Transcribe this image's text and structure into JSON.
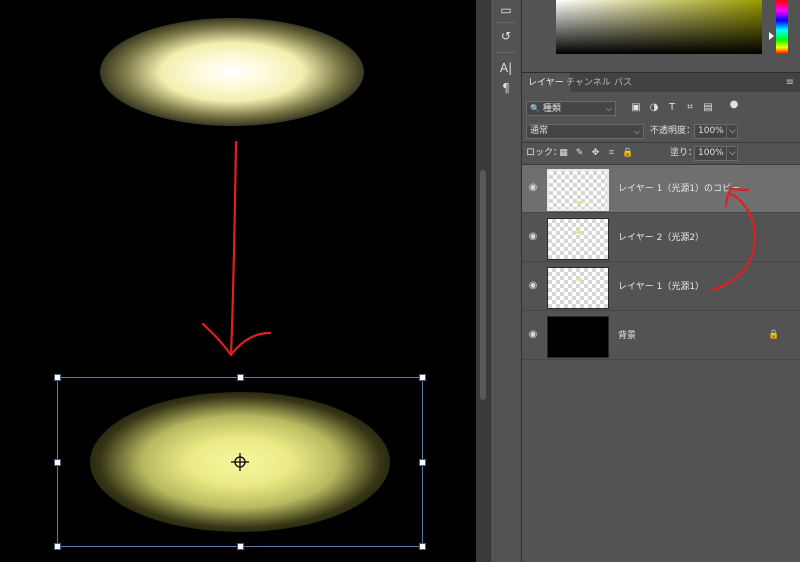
{
  "canvas": {
    "annotation_color": "#e02020",
    "transform_box_color": "#5d7aa6"
  },
  "toolstrip": {
    "icons": [
      "comment-icon",
      "history-icon",
      "character-icon",
      "paragraph-icon"
    ],
    "glyphs": [
      "▭",
      "↺",
      "A|",
      "¶"
    ]
  },
  "color_picker": {
    "hue_color": "#9a9a00"
  },
  "layers_panel": {
    "tabs": [
      {
        "label": "レイヤー",
        "active": true
      },
      {
        "label": "チャンネル",
        "active": false
      },
      {
        "label": "パス",
        "active": false
      }
    ],
    "menu_glyph": "≡",
    "filter": {
      "value": "種類",
      "search_glyph": "🔍",
      "arrow": "⌵"
    },
    "filter_icons": [
      "▣",
      "◑",
      "T",
      "⌗",
      "▤",
      "●"
    ],
    "blend_mode": {
      "value": "通常",
      "arrow": "⌵"
    },
    "opacity": {
      "label": "不透明度：",
      "value": "100%",
      "arrow": "⌵"
    },
    "lock": {
      "label": "ロック：",
      "icons": [
        "▦",
        "✎",
        "✥",
        "⌗",
        "🔒"
      ]
    },
    "fill": {
      "label": "塗り：",
      "value": "100%",
      "arrow": "⌵"
    },
    "layers": [
      {
        "name": "レイヤー 1（光源1）のコピー",
        "selected": true,
        "visible_glyph": "◉",
        "transparent": true
      },
      {
        "name": "レイヤー 2（光源2）",
        "selected": false,
        "visible_glyph": "◉",
        "transparent": true
      },
      {
        "name": "レイヤー 1（光源1）",
        "selected": false,
        "visible_glyph": "◉",
        "transparent": true
      },
      {
        "name": "背景",
        "selected": false,
        "visible_glyph": "◉",
        "transparent": false,
        "lock_glyph": "🔒"
      }
    ]
  }
}
